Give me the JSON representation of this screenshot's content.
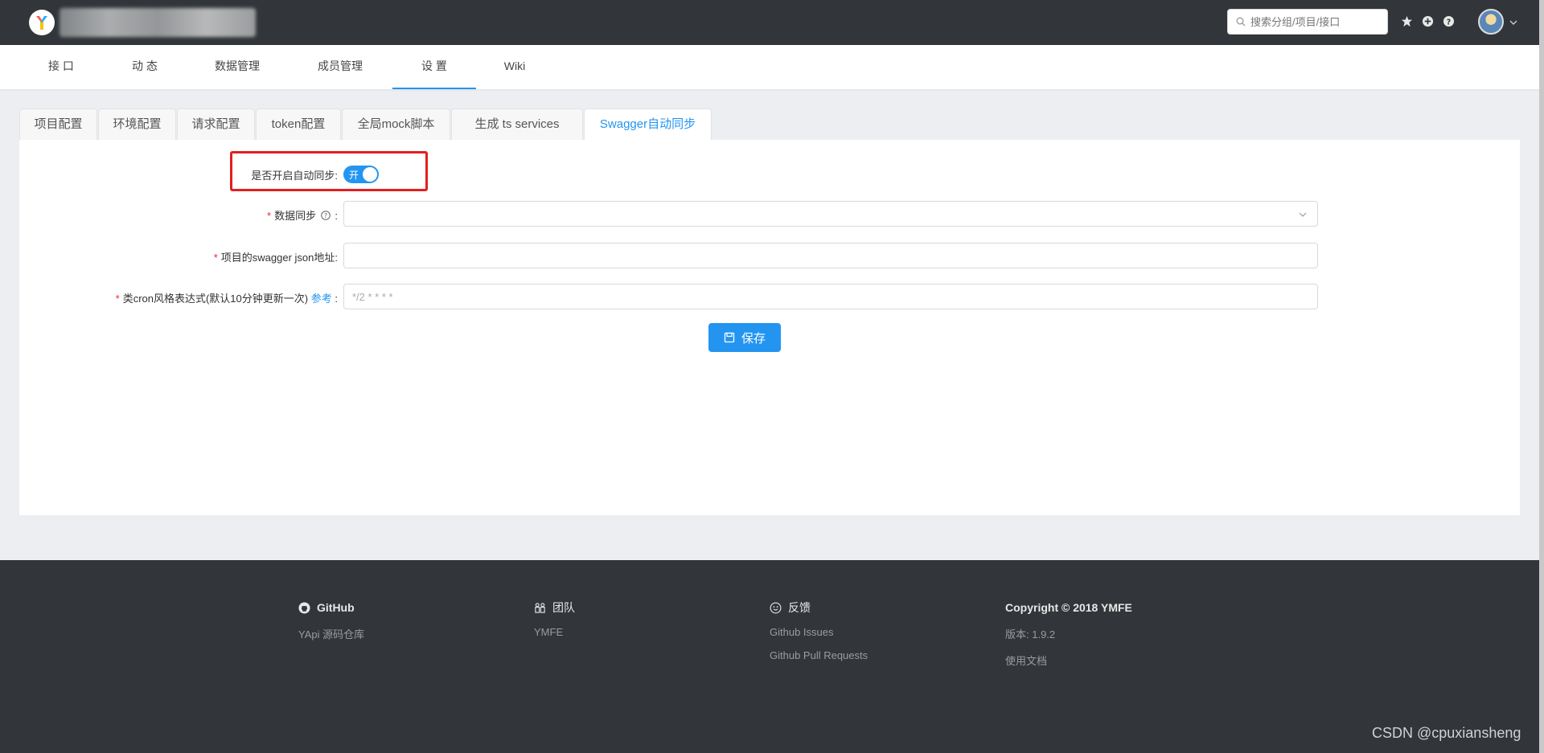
{
  "header": {
    "search_placeholder": "搜索分组/项目/接口"
  },
  "nav": {
    "items": [
      "接 口",
      "动 态",
      "数据管理",
      "成员管理",
      "设 置",
      "Wiki"
    ],
    "active_index": 4
  },
  "tabs": {
    "items": [
      "项目配置",
      "环境配置",
      "请求配置",
      "token配置",
      "全局mock脚本",
      "生成 ts services",
      "Swagger自动同步"
    ],
    "active_index": 6
  },
  "form": {
    "auto_sync_label": "是否开启自动同步",
    "colon": ":",
    "auto_sync_state": "开",
    "data_sync_label": "数据同步",
    "data_sync_value": "",
    "swagger_url_label": "项目的swagger json地址",
    "swagger_url_value": "",
    "cron_label": "类cron风格表达式(默认10分钟更新一次)",
    "cron_link": "参考",
    "cron_placeholder": "*/2 * * * *",
    "required_mark": "*",
    "save_label": "保存"
  },
  "footer": {
    "github_title": "GitHub",
    "github_link": "YApi 源码仓库",
    "team_title": "团队",
    "team_link": "YMFE",
    "feedback_title": "反馈",
    "feedback_links": [
      "Github Issues",
      "Github Pull Requests"
    ],
    "copyright": "Copyright © 2018 YMFE",
    "version": "版本: 1.9.2",
    "docs": "使用文档"
  },
  "watermark": "CSDN @cpuxiansheng",
  "colors": {
    "header_bg": "#32363a",
    "accent": "#2395f1",
    "highlight": "#e41e1e",
    "required": "#f5222d"
  }
}
